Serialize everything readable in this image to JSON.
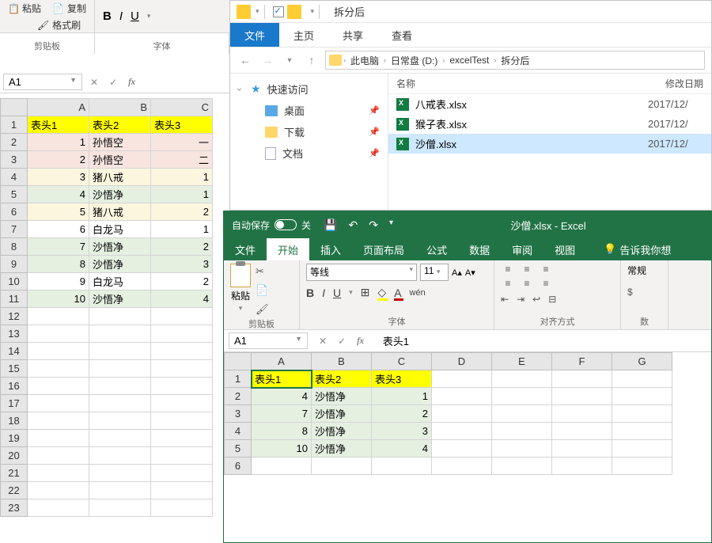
{
  "excel_left": {
    "ribbon": {
      "paste_label": "粘贴",
      "copy_label": "复制",
      "format_painter": "格式刷",
      "clipboard_group": "剪贴板",
      "font_group": "字体",
      "bold": "B",
      "italic": "I",
      "underline": "U"
    },
    "name_box": "A1",
    "columns": [
      "A",
      "B",
      "C"
    ],
    "rows": [
      {
        "n": 1,
        "cls": "hdr",
        "a": "表头1",
        "b": "表头2",
        "c": "表头3"
      },
      {
        "n": 2,
        "cls": "bg-pink",
        "a": "1",
        "b": "孙悟空",
        "c": "一"
      },
      {
        "n": 3,
        "cls": "bg-pink",
        "a": "2",
        "b": "孙悟空",
        "c": "二"
      },
      {
        "n": 4,
        "cls": "bg-yellowish",
        "a": "3",
        "b": "猪八戒",
        "c": "1"
      },
      {
        "n": 5,
        "cls": "bg-green",
        "a": "4",
        "b": "沙悟净",
        "c": "1"
      },
      {
        "n": 6,
        "cls": "bg-yellowish",
        "a": "5",
        "b": "猪八戒",
        "c": "2"
      },
      {
        "n": 7,
        "cls": "",
        "a": "6",
        "b": "白龙马",
        "c": "1"
      },
      {
        "n": 8,
        "cls": "bg-green",
        "a": "7",
        "b": "沙悟净",
        "c": "2"
      },
      {
        "n": 9,
        "cls": "bg-green",
        "a": "8",
        "b": "沙悟净",
        "c": "3"
      },
      {
        "n": 10,
        "cls": "",
        "a": "9",
        "b": "白龙马",
        "c": "2"
      },
      {
        "n": 11,
        "cls": "bg-green",
        "a": "10",
        "b": "沙悟净",
        "c": "4"
      },
      {
        "n": 12
      },
      {
        "n": 13
      },
      {
        "n": 14
      },
      {
        "n": 15
      },
      {
        "n": 16
      },
      {
        "n": 17
      },
      {
        "n": 18
      },
      {
        "n": 19
      },
      {
        "n": 20
      },
      {
        "n": 21
      },
      {
        "n": 22
      },
      {
        "n": 23
      }
    ]
  },
  "explorer": {
    "title": "拆分后",
    "tabs": {
      "file": "文件",
      "home": "主页",
      "share": "共享",
      "view": "查看"
    },
    "breadcrumbs": [
      "此电脑",
      "日常盘 (D:)",
      "excelTest",
      "拆分后"
    ],
    "sidebar": {
      "quick_access": "快速访问",
      "desktop": "桌面",
      "downloads": "下载",
      "documents": "文档"
    },
    "columns": {
      "name": "名称",
      "modified": "修改日期"
    },
    "files": [
      {
        "name": "八戒表.xlsx",
        "date": "2017/12/",
        "selected": false
      },
      {
        "name": "猴子表.xlsx",
        "date": "2017/12/",
        "selected": false
      },
      {
        "name": "沙僧.xlsx",
        "date": "2017/12/",
        "selected": true
      }
    ]
  },
  "excel2": {
    "autosave": "自动保存",
    "autosave_state": "关",
    "window_title": "沙僧.xlsx - Excel",
    "ribbon_tabs": {
      "file": "文件",
      "home": "开始",
      "insert": "插入",
      "layout": "页面布局",
      "formulas": "公式",
      "data": "数据",
      "review": "审阅",
      "view": "视图",
      "tell_me": "告诉我你想"
    },
    "ribbon": {
      "paste": "粘贴",
      "clipboard_group": "剪贴板",
      "font_name": "等线",
      "font_size": "11",
      "font_group": "字体",
      "align_group": "对齐方式",
      "number_group": "数",
      "general": "常规",
      "bold": "B",
      "italic": "I",
      "underline": "U"
    },
    "name_box": "A1",
    "formula_bar": "表头1",
    "columns": [
      "A",
      "B",
      "C",
      "D",
      "E",
      "F",
      "G"
    ],
    "rows": [
      {
        "n": 1,
        "cls": "hdr",
        "a": "表头1",
        "b": "表头2",
        "c": "表头3"
      },
      {
        "n": 2,
        "cls": "data",
        "a": "4",
        "b": "沙悟净",
        "c": "1"
      },
      {
        "n": 3,
        "cls": "data",
        "a": "7",
        "b": "沙悟净",
        "c": "2"
      },
      {
        "n": 4,
        "cls": "data",
        "a": "8",
        "b": "沙悟净",
        "c": "3"
      },
      {
        "n": 5,
        "cls": "data",
        "a": "10",
        "b": "沙悟净",
        "c": "4"
      },
      {
        "n": 6
      }
    ]
  }
}
